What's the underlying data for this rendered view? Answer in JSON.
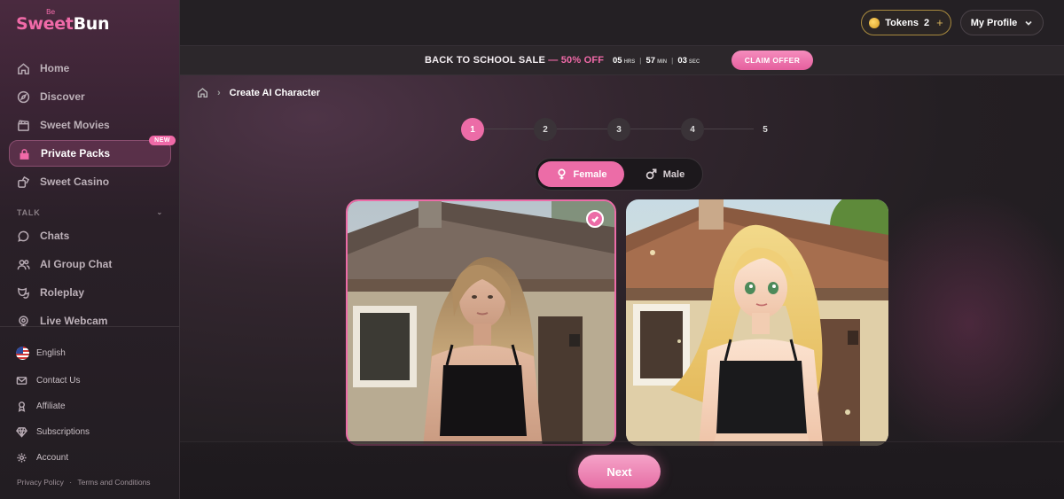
{
  "brand": {
    "sup": "Be",
    "part1": "Sweet",
    "part2": "Bun"
  },
  "sidebar": {
    "items": [
      {
        "label": "Home",
        "icon": "home-icon"
      },
      {
        "label": "Discover",
        "icon": "compass-icon"
      },
      {
        "label": "Sweet Movies",
        "icon": "clapperboard-icon"
      },
      {
        "label": "Private Packs",
        "icon": "lock-icon",
        "badge": "NEW",
        "active": true
      },
      {
        "label": "Sweet Casino",
        "icon": "dice-icon"
      }
    ],
    "section_label": "TALK",
    "talk_items": [
      {
        "label": "Chats",
        "icon": "chat-bubble-icon"
      },
      {
        "label": "AI Group Chat",
        "icon": "group-icon"
      },
      {
        "label": "Roleplay",
        "icon": "masks-icon"
      },
      {
        "label": "Live Webcam",
        "icon": "webcam-icon"
      }
    ],
    "footer_items": [
      {
        "label": "English",
        "icon": "us-flag-icon"
      },
      {
        "label": "Contact Us",
        "icon": "mail-icon"
      },
      {
        "label": "Affiliate",
        "icon": "affiliate-icon"
      },
      {
        "label": "Subscriptions",
        "icon": "diamond-icon"
      },
      {
        "label": "Account",
        "icon": "gear-icon"
      }
    ],
    "legal": {
      "privacy": "Privacy Policy",
      "dot": "·",
      "terms": "Terms and Conditions"
    }
  },
  "header": {
    "tokens_label": "Tokens",
    "tokens_count": "2",
    "tokens_plus": "+",
    "profile_label": "My Profile"
  },
  "promo": {
    "text": "BACK TO SCHOOL SALE",
    "dash": " — ",
    "highlight": "50% OFF",
    "hours": "05",
    "hours_unit": "HRS",
    "minutes": "57",
    "minutes_unit": "MIN",
    "seconds": "03",
    "seconds_unit": "SEC",
    "cta": "CLAIM OFFER"
  },
  "breadcrumb": {
    "current": "Create AI Character"
  },
  "stepper": {
    "steps": [
      "1",
      "2",
      "3",
      "4",
      "5"
    ],
    "active": 1
  },
  "gender": {
    "female": "Female",
    "male": "Male",
    "selected": "Female"
  },
  "styles": [
    {
      "name": "realistic",
      "selected": true
    },
    {
      "name": "anime",
      "selected": false
    }
  ],
  "actions": {
    "next": "Next"
  },
  "colors": {
    "accent": "#ec6ca7",
    "gold": "#a88a3e"
  }
}
